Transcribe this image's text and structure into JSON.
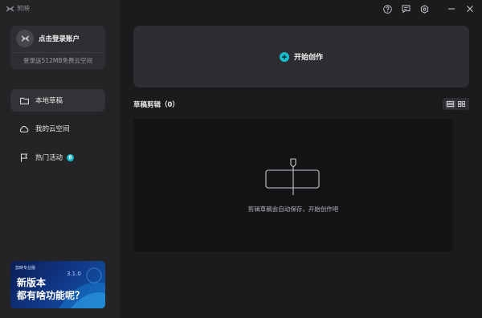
{
  "app": {
    "name": "剪映"
  },
  "account": {
    "login_text": "点击登录账户",
    "promo_text": "登录送512MB免费云空间"
  },
  "nav": {
    "items": [
      {
        "label": "本地草稿",
        "icon": "folder-icon"
      },
      {
        "label": "我的云空间",
        "icon": "cloud-icon"
      },
      {
        "label": "热门活动",
        "icon": "flag-icon",
        "badge": "8"
      }
    ]
  },
  "banner": {
    "tag": "剪映专业版",
    "version": "3.1.0",
    "line1": "新版本",
    "line2": "都有啥功能呢？"
  },
  "window_controls": [
    "help-icon",
    "feedback-icon",
    "settings-icon",
    "minimize-icon",
    "close-icon"
  ],
  "create": {
    "label": "开始创作"
  },
  "drafts": {
    "title": "草稿剪辑（0）",
    "empty_message": "剪辑草稿会自动保存，开始创作吧"
  },
  "colors": {
    "accent": "#16c1cf",
    "sidebar_bg": "#242427",
    "main_bg": "#1b1b1d",
    "banner_bg": "#123a8c"
  }
}
